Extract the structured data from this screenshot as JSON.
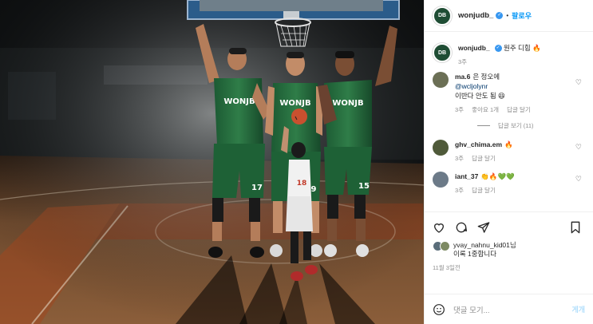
{
  "post_header": {
    "avatar_text": "DB",
    "username": "wonjudb_",
    "verified_mark": "✓",
    "separator": "•",
    "follow_label": "팔로우"
  },
  "photo": {
    "jersey_text": "WONJB",
    "numbers": [
      "17",
      "9",
      "15",
      "18"
    ]
  },
  "caption": {
    "username": "wonjudb_",
    "text": "원주 디힘 🔥",
    "time": "3주"
  },
  "comments": [
    {
      "username": "ma.6",
      "text": "은 정오에",
      "mention": "@wcljolynr",
      "text2": "이반다 안도 됨 😆",
      "time": "3주",
      "likes": "좋아요 1개",
      "reply": "답글 달기",
      "view_replies": "답글 보기 (11)"
    },
    {
      "username": "ghv_chima.em",
      "text": "🔥",
      "time": "3주",
      "reply": "답글 달기"
    },
    {
      "username": "iant_37",
      "text": "👏🔥💚💚",
      "time": "3주",
      "reply": "답글 달기"
    }
  ],
  "likes": {
    "text_line1": "yvay_nahnu_kid01님",
    "text_line2": "이록 1중합니다"
  },
  "date": "11월 3일전",
  "add_comment": {
    "placeholder": "댓글 모기...",
    "post_label": "게개"
  },
  "icons": {
    "like": "heart-icon",
    "comment": "comment-icon",
    "share": "share-icon",
    "save": "bookmark-icon",
    "emoji": "emoji-icon"
  },
  "colors": {
    "brand_green": "#1f6b3a",
    "link_blue": "#0095f6",
    "verified_blue": "#3897f0"
  }
}
